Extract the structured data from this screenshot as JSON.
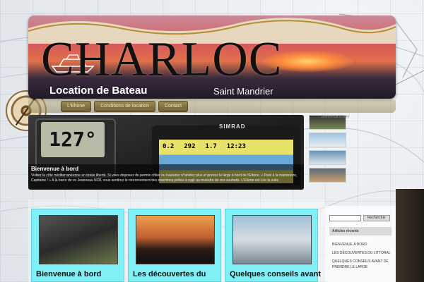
{
  "header": {
    "brand": "CHARLOC",
    "tagline": "Location de Bateau",
    "location": "Saint Mandrier"
  },
  "nav": {
    "items": [
      "L'Eltone",
      "Conditions de location",
      "Contact"
    ]
  },
  "slider": {
    "depth_display": "127°",
    "gps_brand": "SIMRAD",
    "gps_values": [
      "0.2",
      "292",
      "1.7",
      "12:23"
    ],
    "caption_title": "Bienvenue à bord",
    "caption_text": "Visitez la côte méditerranéenne en totale liberté. Si vous disposez du permis côtier ou hauturier n'hésitez plus et prenez le large à bord de l'Eltone. « Paré à la manœuvre, Capitaine ! » A la barre de ce Jeanneau NC8, vous sentirez le ronronnement des machines prêtes à rugir au moindre de vos souhaits.    L'Eltone est Lire la suite"
  },
  "thumb_label": "Bienvenue à bord",
  "cards": [
    {
      "title": "Bienvenue à bord"
    },
    {
      "title": "Les découvertes du"
    },
    {
      "title": "Quelques conseils avant"
    }
  ],
  "sidebar": {
    "search_button": "Rechercher",
    "recent_title": "Articles récents",
    "recent_items": [
      "BIENVENUE À BORD",
      "LES DÉCOUVERTES DU LITTORAL",
      "QUELQUES CONSEILS AVANT DE PRENDRE LE LARGE"
    ]
  },
  "colors": {
    "card_bg": "#7ff0f6",
    "nav_bg": "#9c8a55"
  }
}
